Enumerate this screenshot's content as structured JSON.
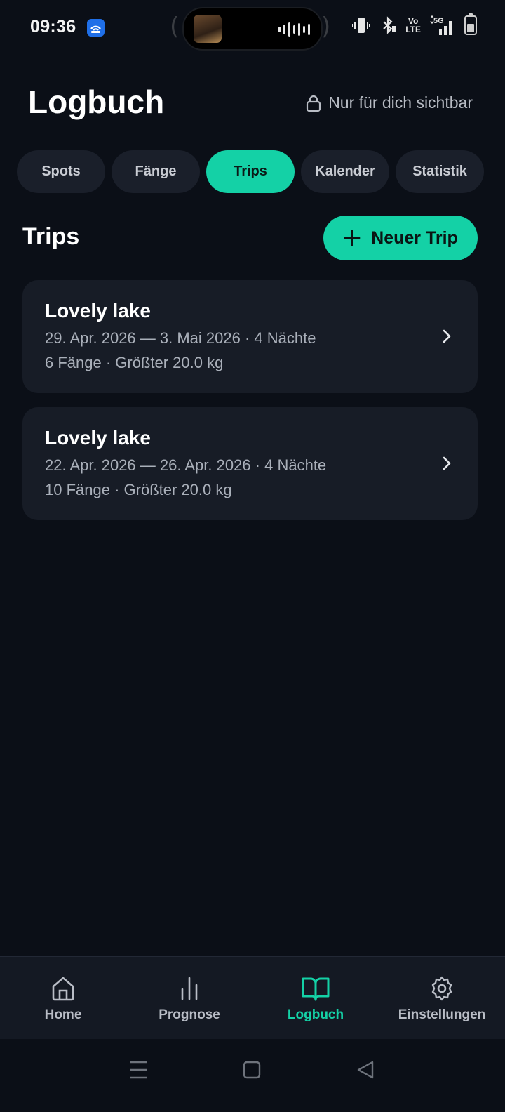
{
  "status_bar": {
    "time": "09:36",
    "app_icon": "wifi-app-icon",
    "volte": "Vo\nLTE",
    "network": "5G",
    "battery_level": 0.5
  },
  "header": {
    "title": "Logbuch",
    "visibility_label": "Nur für dich sichtbar",
    "visibility_icon": "lock-icon"
  },
  "tabs": [
    {
      "label": "Spots",
      "active": false
    },
    {
      "label": "Fänge",
      "active": false
    },
    {
      "label": "Trips",
      "active": true
    },
    {
      "label": "Kalender",
      "active": false
    },
    {
      "label": "Statistik",
      "active": false
    }
  ],
  "section": {
    "title": "Trips",
    "new_button_label": "Neuer Trip",
    "new_button_icon": "plus-icon"
  },
  "trips": [
    {
      "title": "Lovely lake",
      "dates": "29. Apr. 2026 — 3. Mai 2026 · 4 Nächte",
      "summary": "6 Fänge · Größter 20.0 kg"
    },
    {
      "title": "Lovely lake",
      "dates": "22. Apr. 2026 — 26. Apr. 2026 · 4 Nächte",
      "summary": "10 Fänge · Größter 20.0 kg"
    }
  ],
  "bottom_nav": [
    {
      "label": "Home",
      "icon": "home-icon",
      "active": false
    },
    {
      "label": "Prognose",
      "icon": "bar-chart-icon",
      "active": false
    },
    {
      "label": "Logbuch",
      "icon": "book-icon",
      "active": true
    },
    {
      "label": "Einstellungen",
      "icon": "gear-icon",
      "active": false
    }
  ],
  "colors": {
    "background": "#0b0f17",
    "accent": "#14d1a6",
    "card": "#171c26"
  }
}
